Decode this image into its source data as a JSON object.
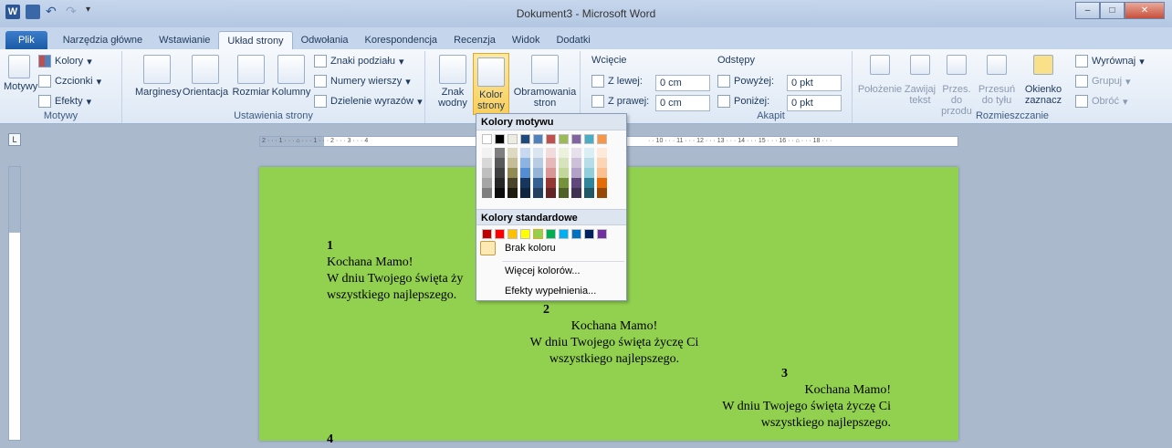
{
  "window": {
    "title": "Dokument3 - Microsoft Word",
    "app_icon": "W"
  },
  "tabs": [
    "Plik",
    "Narzędzia główne",
    "Wstawianie",
    "Układ strony",
    "Odwołania",
    "Korespondencja",
    "Recenzja",
    "Widok",
    "Dodatki"
  ],
  "ribbon": {
    "motywy": {
      "label": "Motywy",
      "btn": "Motywy",
      "kolory": "Kolory",
      "czcionki": "Czcionki",
      "efekty": "Efekty"
    },
    "ustawienia": {
      "label": "Ustawienia strony",
      "marginesy": "Marginesy",
      "orientacja": "Orientacja",
      "rozmiar": "Rozmiar",
      "kolumny": "Kolumny",
      "znaki": "Znaki podziału",
      "numery": "Numery wierszy",
      "dzielenie": "Dzielenie wyrazów"
    },
    "tlo": {
      "znak": "Znak",
      "znak2": "wodny",
      "kolor": "Kolor",
      "kolor2": "strony",
      "obram": "Obramowania",
      "obram2": "stron"
    },
    "akapit": {
      "label": "Akapit",
      "wciecie": "Wcięcie",
      "zlewej": "Z lewej:",
      "zprawej": "Z prawej:",
      "lv": "0 cm",
      "rv": "0 cm",
      "odstepy": "Odstępy",
      "powyzej": "Powyżej:",
      "ponizej": "Poniżej:",
      "pv": "0 pkt",
      "nv": "0 pkt"
    },
    "rozm": {
      "label": "Rozmieszczanie",
      "polozenie": "Położenie",
      "zawijaj": "Zawijaj",
      "zawijaj2": "tekst",
      "przes": "Przes. do",
      "przes2": "przodu",
      "przesun": "Przesuń",
      "przesun2": "do tyłu",
      "okienko": "Okienko",
      "okienko2": "zaznacz",
      "wyrownaj": "Wyrównaj",
      "grupuj": "Grupuj",
      "obroc": "Obróć"
    }
  },
  "ruler": {
    "marks": "2 · · · 1 · · · ⌂ · · · 1 · · · 2 · · · 3 · · · 4",
    "marks2": "· · 10 · · · 11 · · · 12 · · · 13 · · · 14 · · · 15 · · · 16 · · ⌂ · · · 18 · · ·"
  },
  "menu": {
    "head1": "Kolory motywu",
    "head2": "Kolory standardowe",
    "brak": "Brak koloru",
    "wiecej": "Więcej kolorów...",
    "efekty": "Efekty wypełnienia..."
  },
  "colors": {
    "theme": [
      "#ffffff",
      "#000000",
      "#eeece1",
      "#1f497d",
      "#4f81bd",
      "#c0504d",
      "#9bbb59",
      "#8064a2",
      "#4bacc6",
      "#f79646"
    ],
    "shades": [
      [
        "#f2f2f2",
        "#7f7f7f",
        "#ddd9c3",
        "#c6d9f0",
        "#dbe5f1",
        "#f2dcdb",
        "#ebf1dd",
        "#e5e0ec",
        "#dbeef3",
        "#fdeada"
      ],
      [
        "#d8d8d8",
        "#595959",
        "#c4bd97",
        "#8db3e2",
        "#b8cce4",
        "#e5b9b7",
        "#d7e3bc",
        "#ccc1d9",
        "#b7dde8",
        "#fbd5b5"
      ],
      [
        "#bfbfbf",
        "#3f3f3f",
        "#938953",
        "#548dd4",
        "#95b3d7",
        "#d99694",
        "#c3d69b",
        "#b2a2c7",
        "#92cddc",
        "#fac08f"
      ],
      [
        "#a5a5a5",
        "#262626",
        "#494429",
        "#17365d",
        "#366092",
        "#953734",
        "#76923c",
        "#5f497a",
        "#31859b",
        "#e36c09"
      ],
      [
        "#7f7f7f",
        "#0c0c0c",
        "#1d1b10",
        "#0f243e",
        "#244061",
        "#632423",
        "#4f6128",
        "#3f3151",
        "#205867",
        "#974806"
      ]
    ],
    "standard": [
      "#c00000",
      "#ff0000",
      "#ffc000",
      "#ffff00",
      "#92d050",
      "#00b050",
      "#00b0f0",
      "#0070c0",
      "#002060",
      "#7030a0"
    ],
    "page": "#92d050"
  },
  "doc": [
    {
      "num": "1",
      "l1": "Kochana Mamo!",
      "l2": "W dniu Twojego święta ży",
      "l3": "wszystkiego najlepszego."
    },
    {
      "num": "2",
      "l1": "Kochana Mamo!",
      "l2": "W dniu Twojego święta życzę Ci",
      "l3": "wszystkiego najlepszego."
    },
    {
      "num": "3",
      "l1": "Kochana Mamo!",
      "l2": "W dniu Twojego święta życzę Ci",
      "l3": "wszystkiego najlepszego."
    },
    {
      "num": "4"
    }
  ]
}
